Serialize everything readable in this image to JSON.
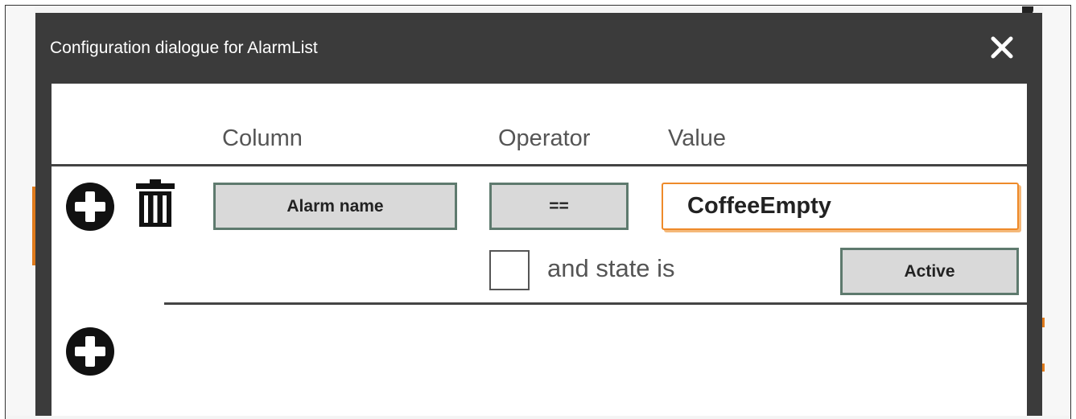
{
  "dialog": {
    "title": "Configuration dialogue for AlarmList",
    "close_icon": "close-icon"
  },
  "columns": {
    "column": "Column",
    "operator": "Operator",
    "value": "Value"
  },
  "filter_row": {
    "add_icon": "plus-circle-icon",
    "delete_icon": "trash-icon",
    "column_select": "Alarm name",
    "operator_select": "==",
    "value_input": "CoffeeEmpty",
    "state_checkbox_checked": false,
    "state_label": "and state is",
    "state_select": "Active"
  },
  "add_row": {
    "add_icon": "plus-circle-icon"
  },
  "colors": {
    "titlebar": "#3b3b3b",
    "select_border": "#5e7a6e",
    "select_fill": "#d9d9d9",
    "input_focus": "#ee8a2a"
  }
}
